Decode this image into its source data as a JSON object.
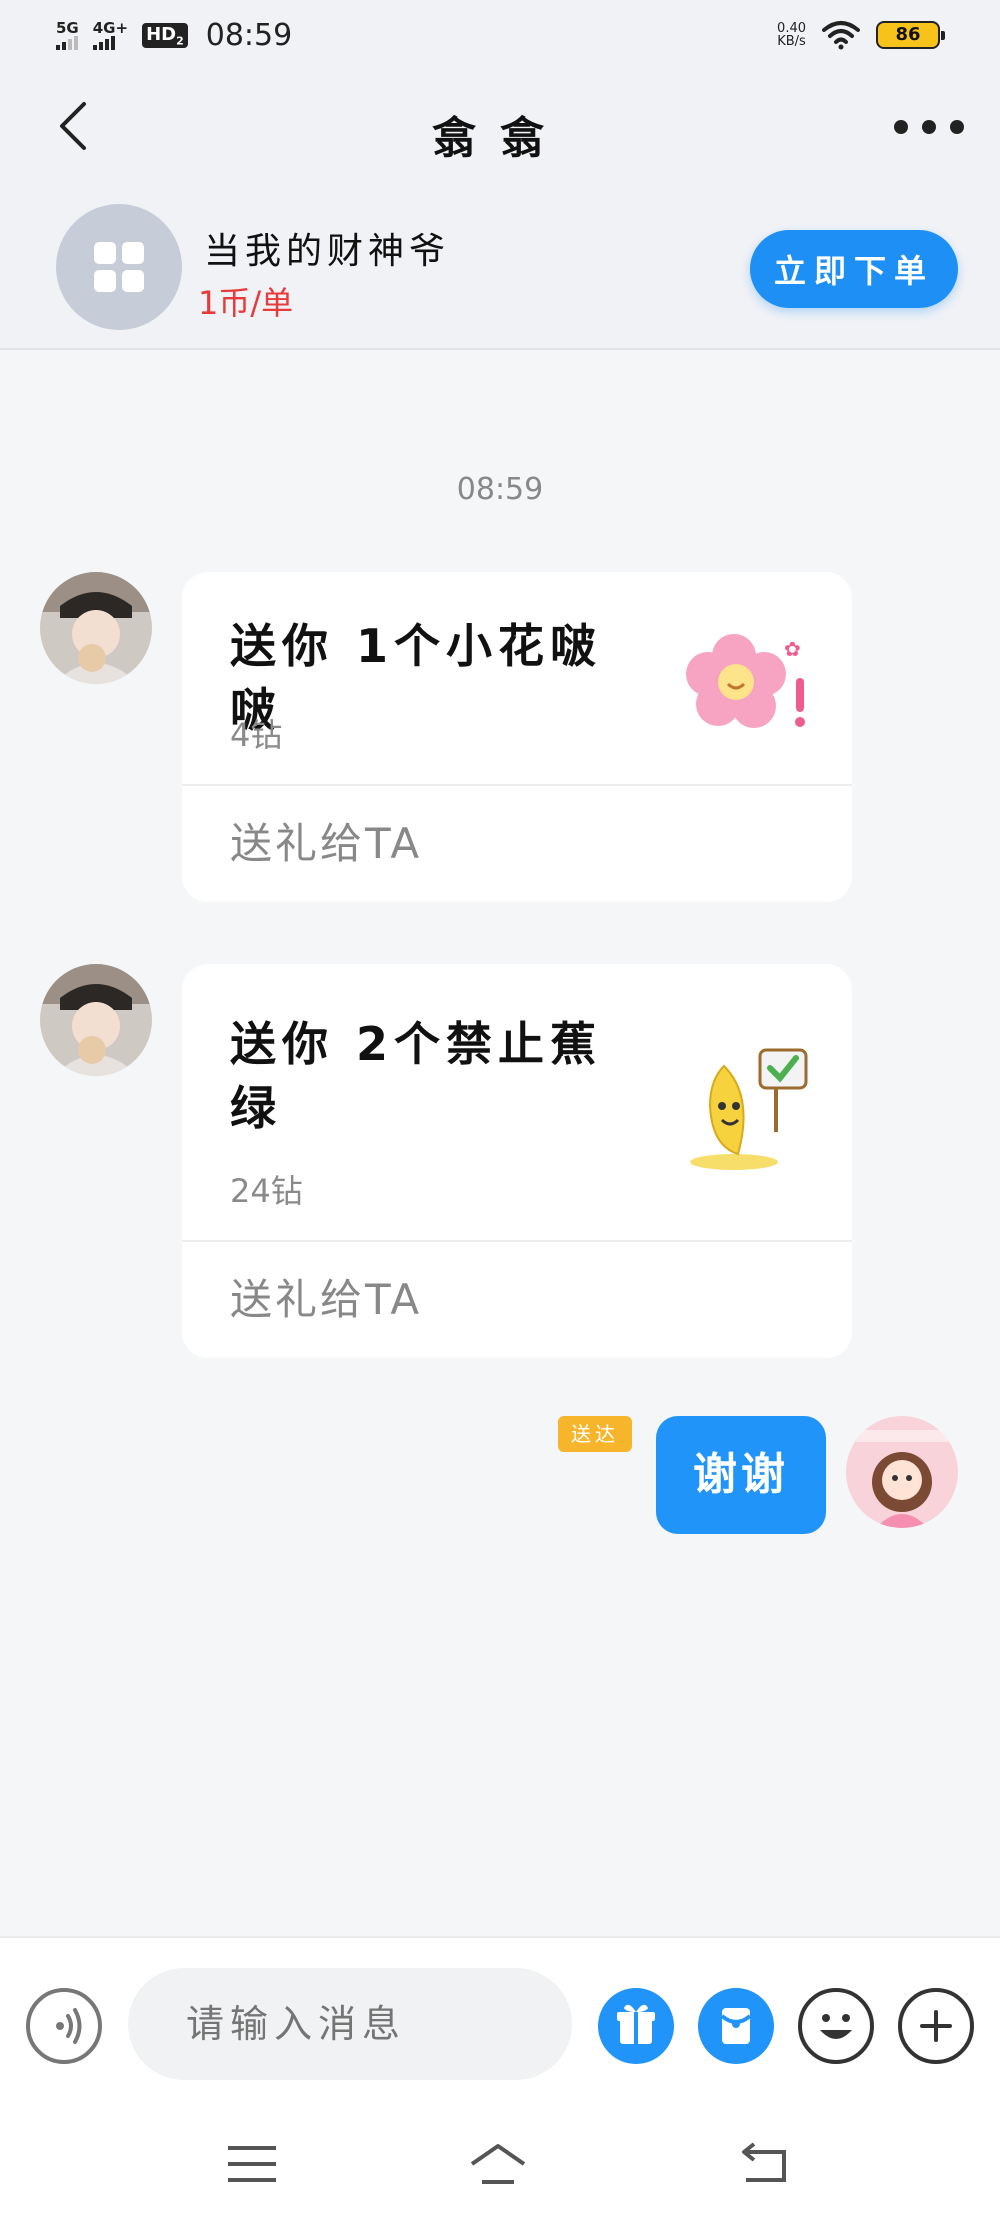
{
  "status_bar": {
    "sim1": "5G",
    "sim2": "4G+",
    "hd_label": "HD",
    "hd_sub": "2",
    "time": "08:59",
    "net_speed_value": "0.40",
    "net_speed_unit": "KB/s",
    "battery": "86"
  },
  "header": {
    "title": "翕翕",
    "back_icon": "back-arrow-icon",
    "more_icon": "more-dots-icon"
  },
  "service": {
    "icon": "grid-app-icon",
    "name": "当我的财神爷",
    "price": "1币/单",
    "order_button": "立即下单"
  },
  "chat": {
    "timestamp": "08:59",
    "messages": [
      {
        "type": "gift",
        "gift_title": "送你 1个小花啵啵",
        "price": "4钻",
        "action": "送礼给TA",
        "image": "pink-flower-icon"
      },
      {
        "type": "gift",
        "gift_title": "送你 2个禁止蕉绿",
        "price": "24钻",
        "action": "送礼给TA",
        "image": "banana-icon"
      },
      {
        "type": "text",
        "text": "谢谢",
        "status": "送达"
      }
    ]
  },
  "input_bar": {
    "placeholder": "请输入消息"
  },
  "colors": {
    "accent": "#2094f8",
    "price_red": "#e63b3b",
    "delivered_badge": "#f7b52c"
  }
}
